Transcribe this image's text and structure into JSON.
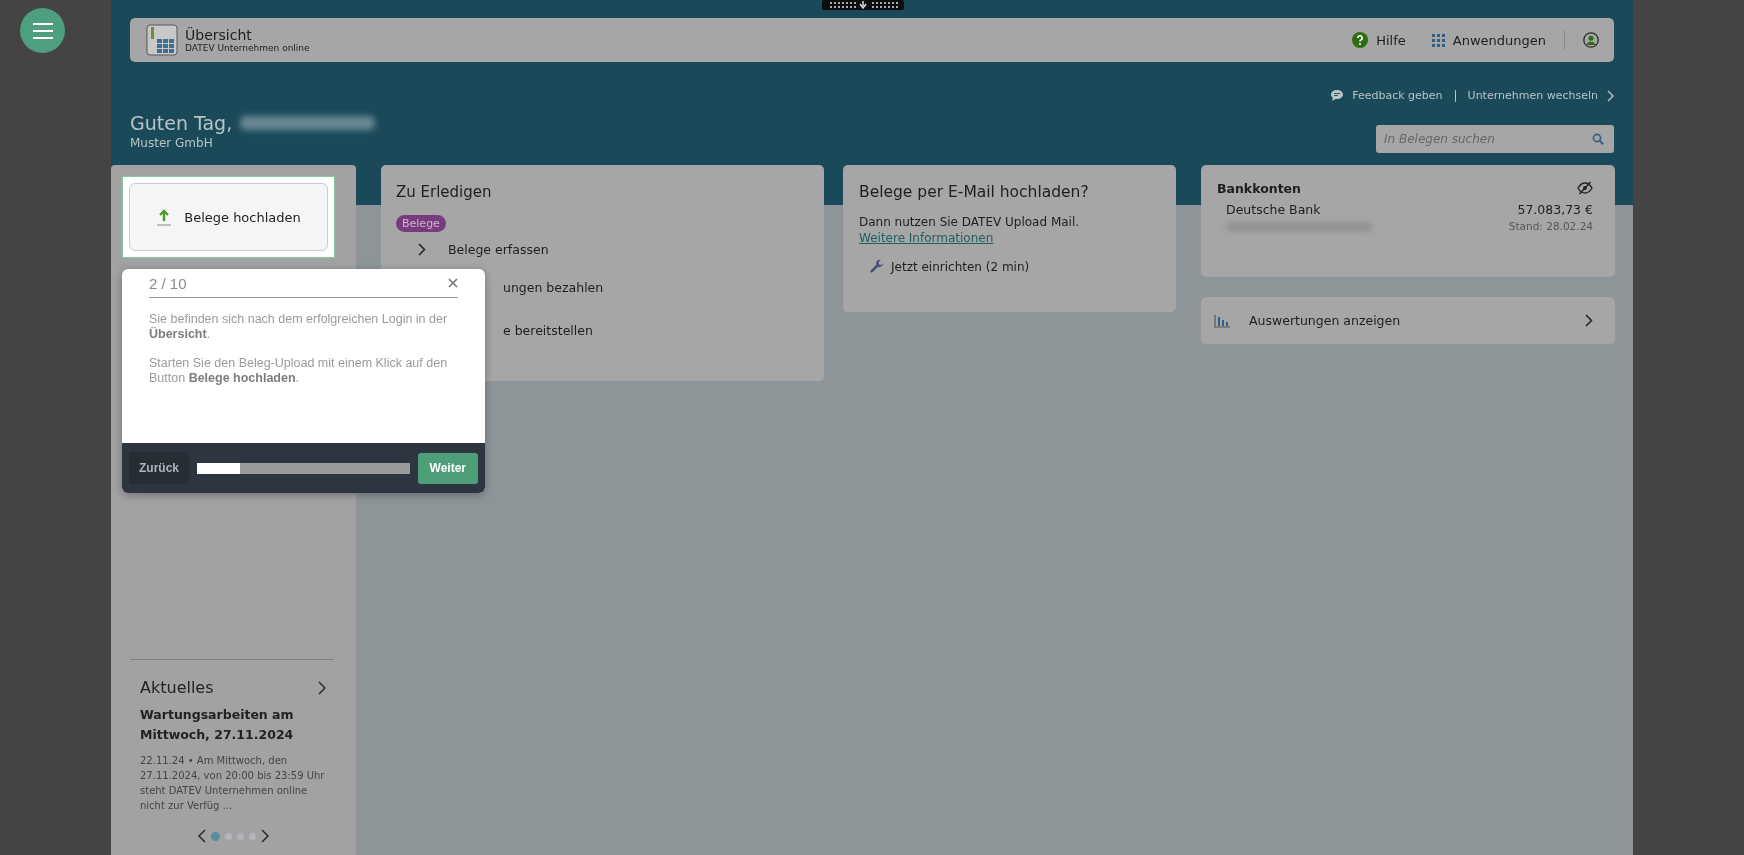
{
  "topbar": {
    "title": "Übersicht",
    "subtitle": "DATEV Unternehmen online",
    "actions": [
      {
        "kind": "help",
        "label": "Hilfe"
      },
      {
        "kind": "apps",
        "label": "Anwendungen"
      },
      {
        "kind": "user"
      }
    ]
  },
  "header_links": [
    "Feedback geben",
    "Unternehmen wechseln"
  ],
  "greeting": {
    "text": "Guten Tag,",
    "company": "Muster GmbH"
  },
  "search": {
    "placeholder": "In Belegen suchen"
  },
  "upload_button": {
    "label": "Belege hochladen"
  },
  "todo": {
    "title": "Zu Erledigen",
    "tag": "Belege",
    "items": [
      {
        "label": "Belege erfassen",
        "covered": false
      },
      {
        "label": "ungen bezahlen",
        "covered": true
      },
      {
        "label": "e bereitstellen",
        "covered": true
      }
    ]
  },
  "email_card": {
    "title": "Belege per E-Mail hochladen?",
    "text": "Dann nutzen Sie DATEV Upload Mail.",
    "link": "Weitere Informationen",
    "action": "Jetzt einrichten (2 min)"
  },
  "bank": {
    "title": "Bankkonten",
    "accounts": [
      {
        "name": "Deutsche Bank",
        "amount": "57.083,73 €",
        "date": "Stand: 28.02.24"
      }
    ]
  },
  "reports": {
    "label": "Auswertungen anzeigen"
  },
  "news": {
    "title": "Aktuelles",
    "headline": "Wartungsarbeiten am Mittwoch, 27.11.2024",
    "body": "22.11.24 • Am Mittwoch, den 27.11.2024, von 20:00 bis 23:59 Uhr steht DATEV Unternehmen online nicht zur Verfüg ...",
    "dots": [
      {
        "selected": true
      },
      {
        "selected": false
      },
      {
        "selected": false
      },
      {
        "selected": false
      }
    ]
  },
  "tour": {
    "step": "2 / 10",
    "paragraphs": [
      "Sie befinden sich nach dem erfolgreichen Login in der **Übersicht**.",
      "Starten Sie den Beleg-Upload mit einem Klick auf den Button **Belege hochladen**."
    ],
    "back": "Zurück",
    "next": "Weiter",
    "level": 0.2
  }
}
